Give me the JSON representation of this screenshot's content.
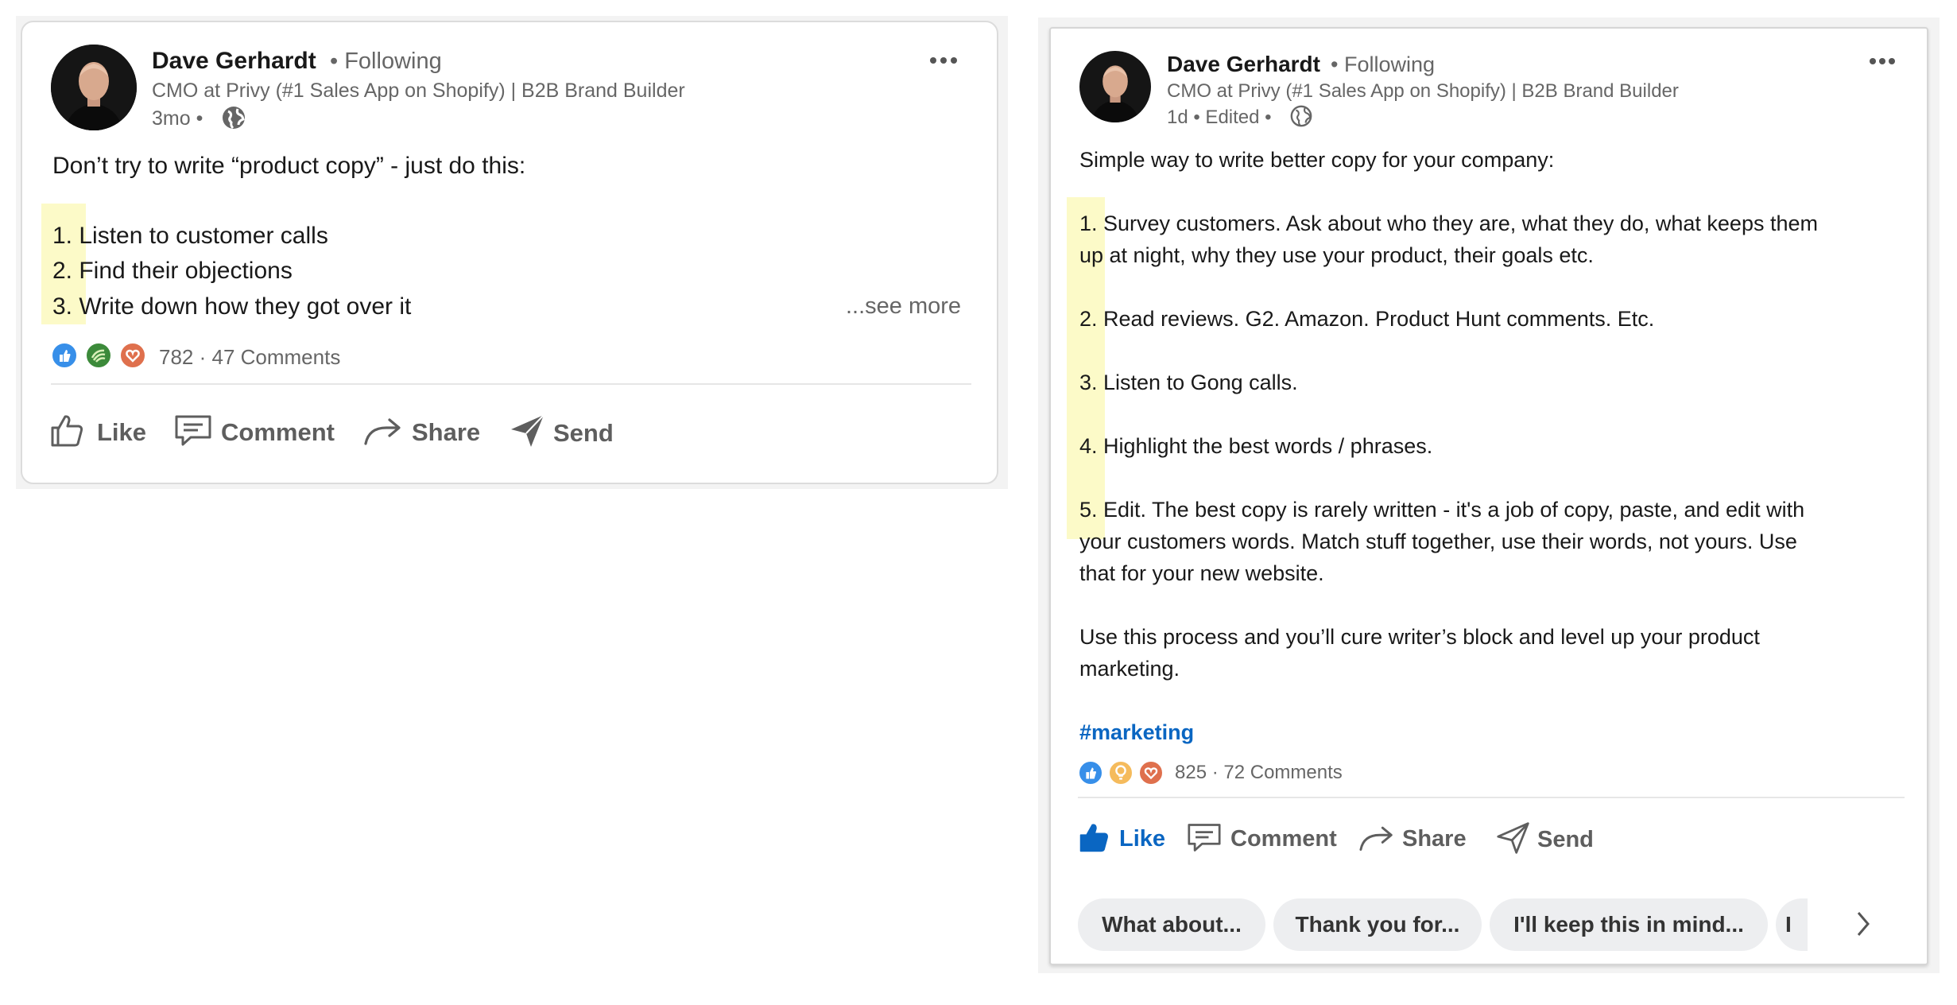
{
  "colors": {
    "text": "#191919",
    "muted": "#666666",
    "action": "#5e5e5e",
    "link": "#0a66c2",
    "highlight": "#fcfac8",
    "chip_bg": "#edeef0",
    "reaction_like": "#378fe9",
    "reaction_support": "#3c8a3a",
    "reaction_love": "#df704d",
    "reaction_insightful": "#f5bb5c"
  },
  "post_left": {
    "author": "Dave Gerhardt",
    "follow_status": "• Following",
    "headline": "CMO at Privy (#1 Sales App on Shopify) | B2B Brand Builder",
    "meta": "3mo •",
    "visibility_icon": "globe-icon",
    "intro": "Don’t try to write “product copy” - just do this:",
    "list": [
      "1. Listen to customer calls",
      "2. Find their objections",
      "3. Write down how they got over it"
    ],
    "see_more": "...see more",
    "reaction_icons": [
      "like-reaction-icon",
      "support-reaction-icon",
      "love-reaction-icon"
    ],
    "reactions": "782 · 47 Comments",
    "actions": {
      "like": "Like",
      "comment": "Comment",
      "share": "Share",
      "send": "Send"
    }
  },
  "post_right": {
    "author": "Dave Gerhardt",
    "follow_status": "• Following",
    "headline": "CMO at Privy (#1 Sales App on Shopify) | B2B Brand Builder",
    "meta": "1d • Edited •",
    "visibility_icon": "globe-icon",
    "lines": [
      "Simple way to write better copy for your company:",
      "1. Survey customers. Ask about who they are, what they do, what keeps them",
      "up at night, why they use your product, their goals etc.",
      "2. Read reviews. G2. Amazon. Product Hunt comments. Etc.",
      "3. Listen to Gong calls.",
      "4. Highlight the best words / phrases.",
      "5. Edit. The best copy is rarely written - it's a job of copy, paste, and edit with",
      "your customers words. Match stuff together, use their words, not yours. Use",
      "that for your new website.",
      "Use this process and you’ll cure writer’s block and level up your product",
      "marketing."
    ],
    "hashtag": "#marketing",
    "reaction_icons": [
      "like-reaction-icon",
      "insightful-reaction-icon",
      "love-reaction-icon"
    ],
    "reactions": "825 · 72 Comments",
    "actions": {
      "like": "Like",
      "comment": "Comment",
      "share": "Share",
      "send": "Send"
    },
    "suggestions": [
      "What about...",
      "Thank you for...",
      "I'll keep this in mind...",
      "I"
    ],
    "next_icon": "chevron-right-icon"
  }
}
